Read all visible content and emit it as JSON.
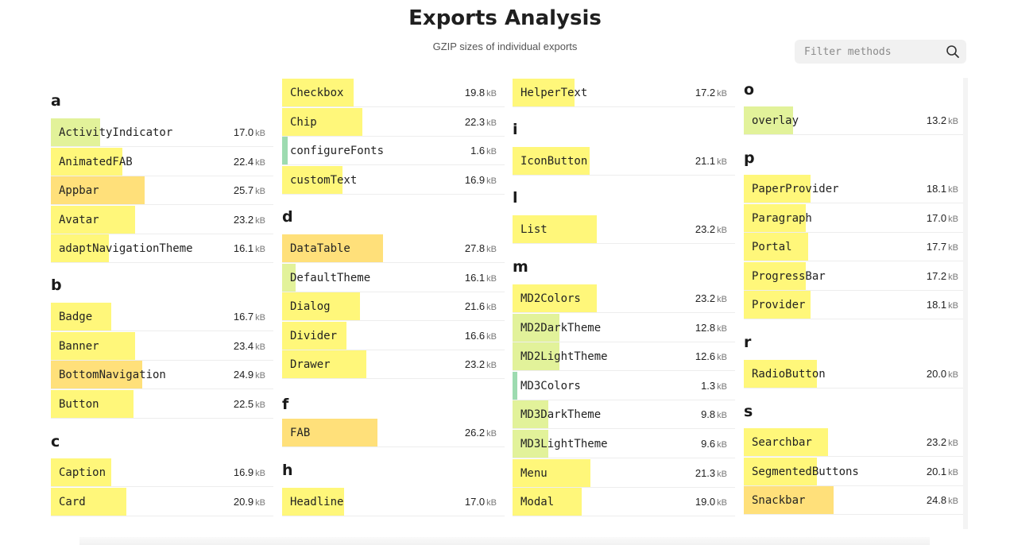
{
  "header": {
    "title": "Exports Analysis",
    "subtitle": "GZIP sizes of individual exports"
  },
  "search": {
    "placeholder": "Filter methods",
    "icon": "search-icon"
  },
  "size_unit": "kB",
  "colors": {
    "bar_default": "#fff77a",
    "bar_large": "#ffe07a",
    "bar_small": "#e2f29a",
    "bar_tiny": "#9ddbb0",
    "row_border": "#ededed"
  },
  "groups": [
    {
      "letter": "a",
      "items": [
        {
          "name": "ActivityIndicator",
          "size": "17.0",
          "level": 0.22
        },
        {
          "name": "AnimatedFAB",
          "size": "22.4",
          "level": 0.32
        },
        {
          "name": "Appbar",
          "size": "25.7",
          "level": 0.42
        },
        {
          "name": "Avatar",
          "size": "23.2",
          "level": 0.38
        },
        {
          "name": "adaptNavigationTheme",
          "size": "16.1",
          "level": 0.26
        }
      ]
    },
    {
      "letter": "b",
      "items": [
        {
          "name": "Badge",
          "size": "16.7",
          "level": 0.27
        },
        {
          "name": "Banner",
          "size": "23.4",
          "level": 0.38
        },
        {
          "name": "BottomNavigation",
          "size": "24.9",
          "level": 0.41
        },
        {
          "name": "Button",
          "size": "22.5",
          "level": 0.37
        }
      ]
    },
    {
      "letter": "c",
      "items": [
        {
          "name": "Caption",
          "size": "16.9",
          "level": 0.27
        },
        {
          "name": "Card",
          "size": "20.9",
          "level": 0.34
        },
        {
          "name": "Checkbox",
          "size": "19.8",
          "level": 0.32
        },
        {
          "name": "Chip",
          "size": "22.3",
          "level": 0.36
        },
        {
          "name": "configureFonts",
          "size": "1.6",
          "level": 0.025
        },
        {
          "name": "customText",
          "size": "16.9",
          "level": 0.27
        }
      ]
    },
    {
      "letter": "d",
      "items": [
        {
          "name": "DataTable",
          "size": "27.8",
          "level": 0.455
        },
        {
          "name": "DefaultTheme",
          "size": "16.1",
          "level": 0.06
        },
        {
          "name": "Dialog",
          "size": "21.6",
          "level": 0.35
        },
        {
          "name": "Divider",
          "size": "16.6",
          "level": 0.29
        },
        {
          "name": "Drawer",
          "size": "23.2",
          "level": 0.38
        }
      ]
    },
    {
      "letter": "f",
      "items": [
        {
          "name": "FAB",
          "size": "26.2",
          "level": 0.43
        }
      ]
    },
    {
      "letter": "h",
      "items": [
        {
          "name": "Headline",
          "size": "17.0",
          "level": 0.28
        },
        {
          "name": "HelperText",
          "size": "17.2",
          "level": 0.28
        }
      ]
    },
    {
      "letter": "i",
      "items": [
        {
          "name": "IconButton",
          "size": "21.1",
          "level": 0.345
        }
      ]
    },
    {
      "letter": "l",
      "items": [
        {
          "name": "List",
          "size": "23.2",
          "level": 0.38
        }
      ]
    },
    {
      "letter": "m",
      "items": [
        {
          "name": "MD2Colors",
          "size": "23.2",
          "level": 0.38
        },
        {
          "name": "MD2DarkTheme",
          "size": "12.8",
          "level": 0.21
        },
        {
          "name": "MD2LightTheme",
          "size": "12.6",
          "level": 0.21
        },
        {
          "name": "MD3Colors",
          "size": "1.3",
          "level": 0.02
        },
        {
          "name": "MD3DarkTheme",
          "size": "9.8",
          "level": 0.16
        },
        {
          "name": "MD3LightTheme",
          "size": "9.6",
          "level": 0.16
        },
        {
          "name": "Menu",
          "size": "21.3",
          "level": 0.35
        },
        {
          "name": "Modal",
          "size": "19.0",
          "level": 0.31
        }
      ]
    },
    {
      "letter": "o",
      "items": [
        {
          "name": "overlay",
          "size": "13.2",
          "level": 0.22
        }
      ]
    },
    {
      "letter": "p",
      "items": [
        {
          "name": "PaperProvider",
          "size": "18.1",
          "level": 0.3
        },
        {
          "name": "Paragraph",
          "size": "17.0",
          "level": 0.28
        },
        {
          "name": "Portal",
          "size": "17.7",
          "level": 0.29
        },
        {
          "name": "ProgressBar",
          "size": "17.2",
          "level": 0.28
        },
        {
          "name": "Provider",
          "size": "18.1",
          "level": 0.3
        }
      ]
    },
    {
      "letter": "r",
      "items": [
        {
          "name": "RadioButton",
          "size": "20.0",
          "level": 0.33
        }
      ]
    },
    {
      "letter": "s",
      "items": [
        {
          "name": "Searchbar",
          "size": "23.2",
          "level": 0.38
        },
        {
          "name": "SegmentedButtons",
          "size": "20.1",
          "level": 0.33
        },
        {
          "name": "Snackbar",
          "size": "24.8",
          "level": 0.405
        }
      ]
    }
  ]
}
